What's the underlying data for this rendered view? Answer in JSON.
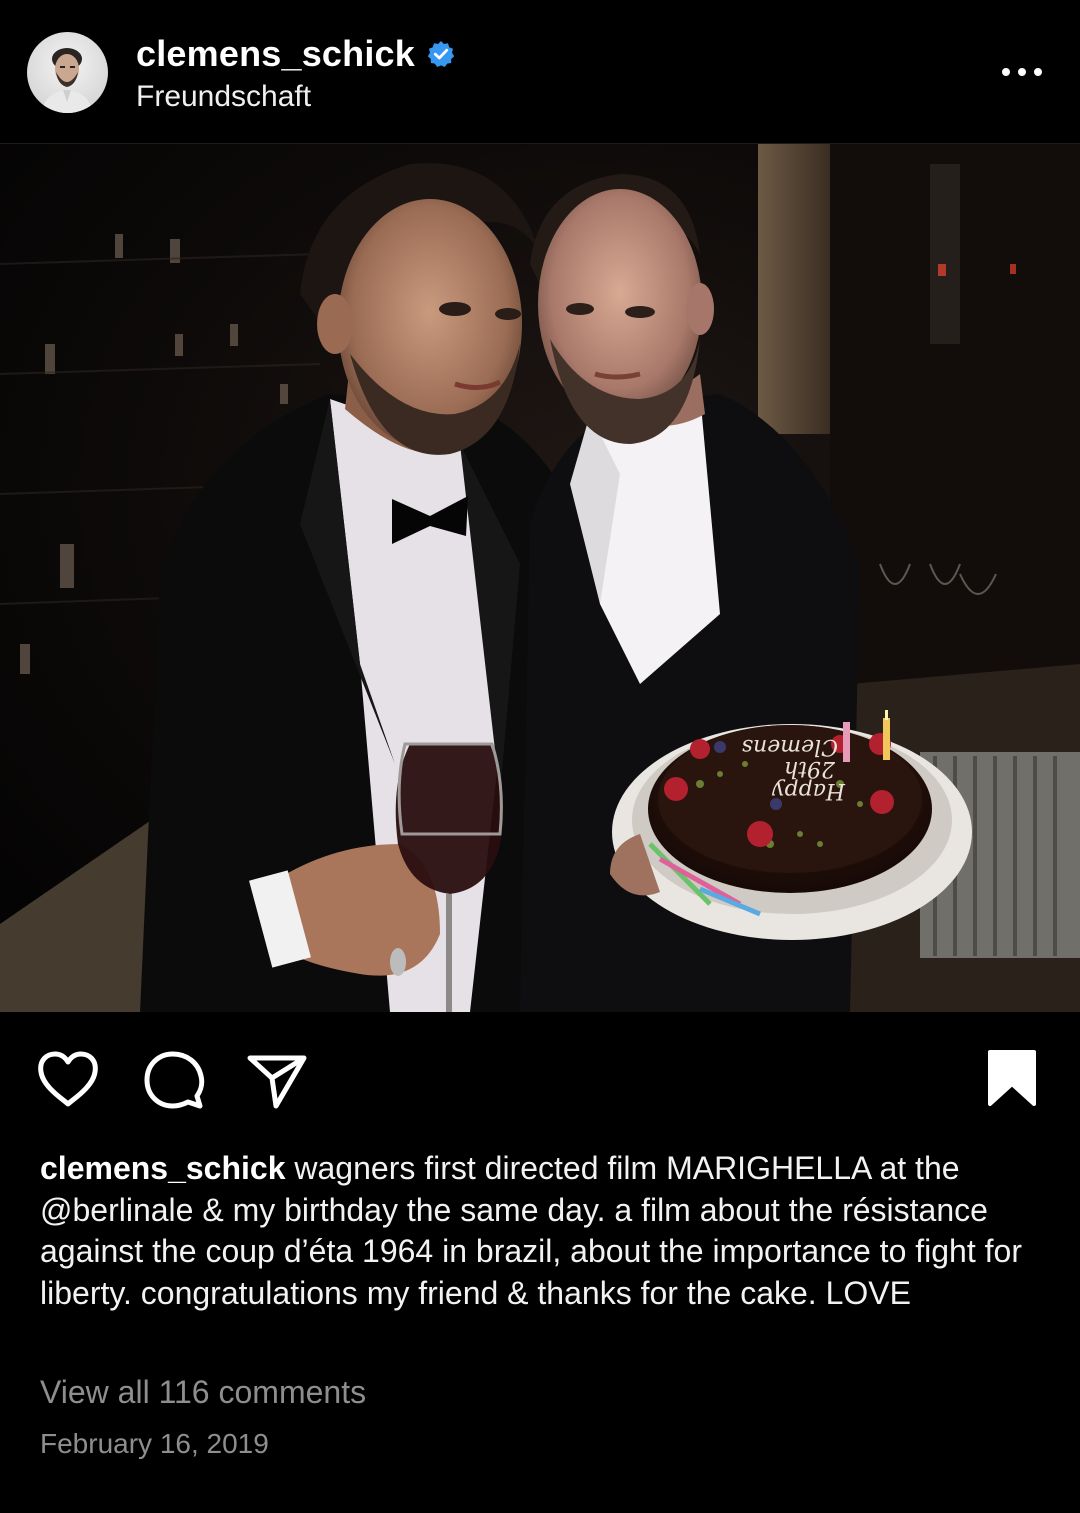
{
  "header": {
    "username": "clemens_schick",
    "location": "Freundschaft",
    "verified": true,
    "more_icon": "more-horizontal-icon"
  },
  "post": {
    "image_alt": "Two men in dark suits; one holds a glass of red wine, the other holds a chocolate birthday cake with candles",
    "cake_text": [
      "Happy",
      "29th",
      "Clemens"
    ]
  },
  "actions": {
    "like_icon": "heart-icon",
    "comment_icon": "comment-icon",
    "share_icon": "send-icon",
    "save_icon": "bookmark-icon",
    "saved": true
  },
  "caption": {
    "username": "clemens_schick",
    "text": "wagners first directed film MARIGHELLA at the @berlinale & my birthday the same day. a film about the résistance against the coup d’éta 1964 in brazil, about the importance to fight for liberty. congratulations my friend & thanks for the cake. LOVE"
  },
  "comments": {
    "view_all_label": "View all 116 comments"
  },
  "date": "February 16, 2019",
  "colors": {
    "background": "#000000",
    "text": "#f5f5f5",
    "muted": "#8e8e8e",
    "verified_blue": "#3897f0"
  }
}
